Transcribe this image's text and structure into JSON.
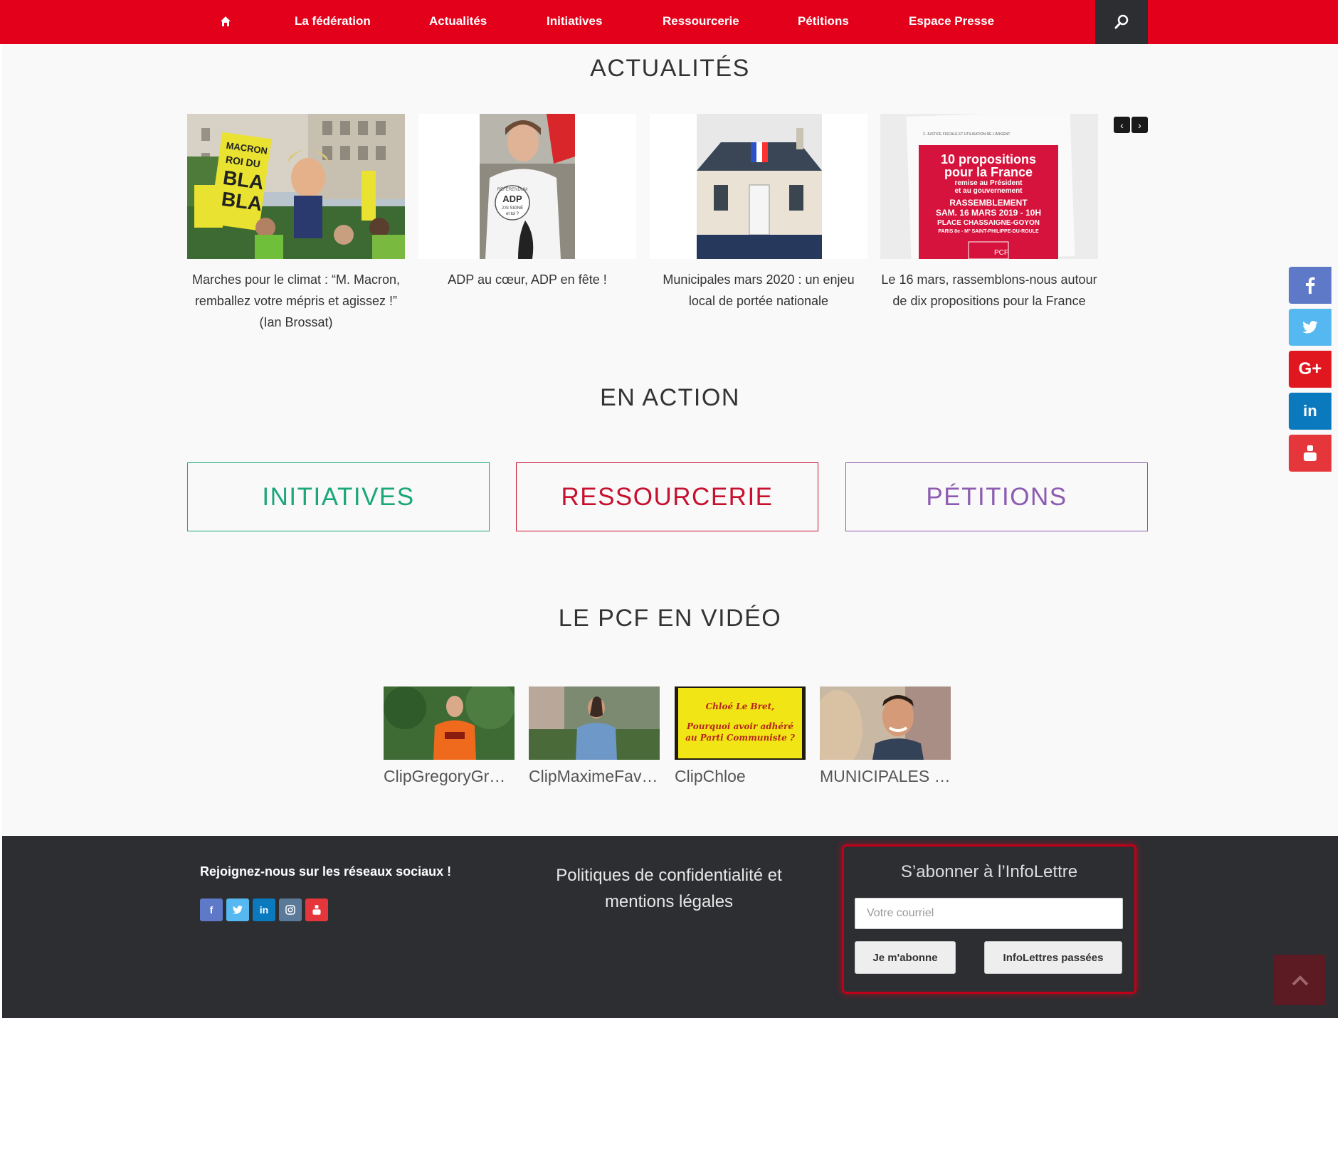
{
  "nav": {
    "items": [
      "La fédération",
      "Actualités",
      "Initiatives",
      "Ressourcerie",
      "Pétitions",
      "Espace Presse"
    ]
  },
  "sections": {
    "actualites": "ACTUALITÉS",
    "en_action": "EN ACTION",
    "video": "LE PCF EN VIDÉO"
  },
  "news": [
    {
      "caption": "Marches pour le climat : “M. Macron, remballez votre mépris et agissez !” (Ian Brossat)",
      "sign_lines": [
        "MACRON",
        "ROI DU",
        "BLA",
        "BLA"
      ]
    },
    {
      "caption": "ADP au cœur, ADP en fête !",
      "shirt_lines": [
        "RÉFÉRENDUM",
        "ADP",
        "J'AI SIGNÉ",
        "et toi ?"
      ]
    },
    {
      "caption": "Municipales mars 2020 : un enjeu local de portée nationale"
    },
    {
      "caption": "Le 16 mars, rassemblons-nous autour de dix propositions pour la France",
      "poster_lines": [
        "10 propositions",
        "pour la France",
        "remise au Président",
        "et au gouvernement",
        "RASSEMBLEMENT",
        "SAM. 16 MARS 2019 - 10H",
        "PLACE CHASSAIGNE-GOYON",
        "PARIS 8e - Mº SAINT-PHILIPPE-DU-ROULE"
      ],
      "poster_logo": "PCF",
      "paper_heading": "2. JUSTICE FISCALE ET UTILISATION DE L'ARGENT"
    }
  ],
  "actions": {
    "initiatives": "INITIATIVES",
    "ressourcerie": "RESSOURCERIE",
    "petitions": "PÉTITIONS"
  },
  "videos": [
    {
      "title": "ClipGregoryGra…"
    },
    {
      "title": "ClipMaximeFavier"
    },
    {
      "title": "ClipChloe",
      "thumb_lines": [
        "Chloé Le Bret,",
        "Pourquoi avoir adhéré",
        "au Parti Communiste ?"
      ]
    },
    {
      "title": "MUNICIPALES …"
    }
  ],
  "footer": {
    "join": "Rejoignez-nous sur les réseaux sociaux !",
    "legal": "Politiques de confidentialité et mentions légales",
    "newsletter": {
      "title": "S’abonner à l’InfoLettre",
      "placeholder": "Votre courriel",
      "subscribe": "Je m'abonne",
      "past": "InfoLettres passées"
    }
  },
  "colors": {
    "brand_red": "#e2001a",
    "dark": "#2d2e32",
    "initiatives": "#1aa77a",
    "ressourcerie": "#c6102e",
    "petitions": "#8d5bb0",
    "facebook": "#3b5998",
    "twitter": "#55acee",
    "googleplus": "#e02f2f",
    "linkedin": "#0077b5",
    "youtube": "#e52d27"
  },
  "icons": {
    "nav_home": "home-icon",
    "nav_search": "search-icon",
    "carousel": [
      "chevron-left-icon",
      "chevron-right-icon"
    ],
    "share": [
      "facebook-icon",
      "twitter-icon",
      "google-plus-icon",
      "linkedin-icon",
      "youtube-icon"
    ],
    "footer_social": [
      "facebook-icon",
      "twitter-icon",
      "linkedin-icon",
      "instagram-icon",
      "youtube-icon"
    ],
    "back_to_top": "chevron-up-icon"
  }
}
